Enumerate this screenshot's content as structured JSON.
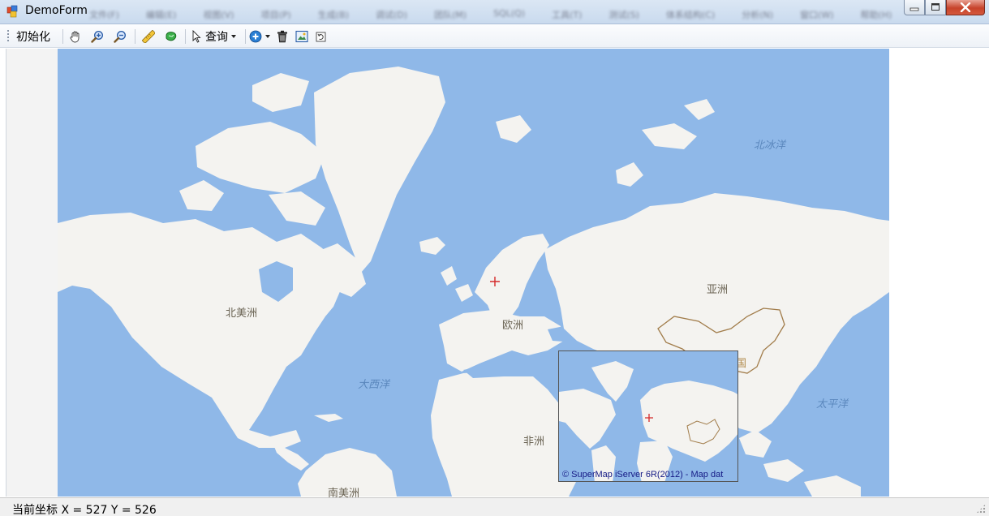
{
  "window": {
    "title": "DemoForm",
    "background_menu_blurred": [
      "文件(F)",
      "编辑(E)",
      "视图(V)",
      "项目(P)",
      "生成(B)",
      "调试(D)",
      "团队(M)",
      "SQL(Q)",
      "工具(T)",
      "测试(S)",
      "体系结构(C)",
      "分析(N)",
      "窗口(W)",
      "帮助(H)"
    ]
  },
  "toolbar": {
    "init_label": "初始化",
    "query_label": "查询",
    "icons": [
      "pan-hand-icon",
      "zoom-in-icon",
      "zoom-out-icon",
      "measure-ruler-icon",
      "measure-area-icon",
      "select-pointer-icon",
      "add-layer-icon",
      "clear-trash-icon",
      "full-extent-icon",
      "refresh-icon"
    ]
  },
  "map": {
    "continents": {
      "north_america": "北美洲",
      "south_america": "南美洲",
      "europe": "欧洲",
      "asia": "亚洲",
      "africa": "非洲",
      "china_partial": "国"
    },
    "oceans": {
      "arctic": "北冰洋",
      "atlantic": "大西洋",
      "pacific": "太平洋"
    },
    "colors": {
      "ocean": "#8fb8e8",
      "land": "#f4f3f0",
      "border": "#a17c4a",
      "marker": "#d42a2a"
    }
  },
  "overview": {
    "copyright": "© SuperMap iServer 6R(2012) - Map dat"
  },
  "status": {
    "coord_label": "当前坐标 X = 527 Y = 526"
  }
}
